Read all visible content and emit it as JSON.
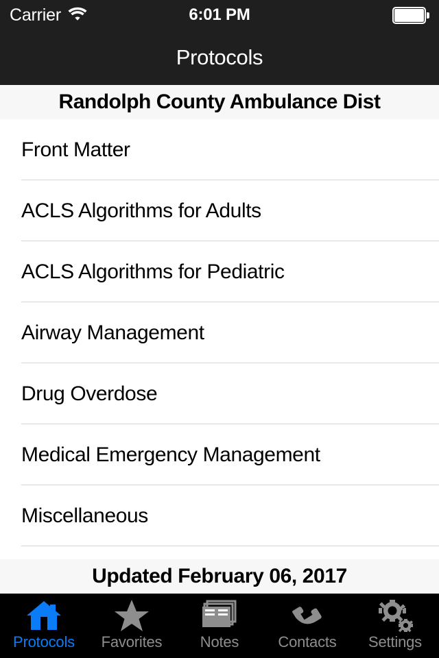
{
  "status_bar": {
    "carrier": "Carrier",
    "wifi_icon": "wifi-icon",
    "time": "6:01 PM",
    "battery_icon": "battery-full-icon"
  },
  "nav": {
    "title": "Protocols"
  },
  "section": {
    "header": "Randolph County Ambulance Dist"
  },
  "list": {
    "items": [
      {
        "label": "Front Matter"
      },
      {
        "label": "ACLS Algorithms for Adults"
      },
      {
        "label": "ACLS Algorithms for Pediatric"
      },
      {
        "label": "Airway Management"
      },
      {
        "label": "Drug Overdose"
      },
      {
        "label": "Medical Emergency Management"
      },
      {
        "label": "Miscellaneous"
      }
    ]
  },
  "footer": {
    "updated": "Updated February 06, 2017"
  },
  "tab_bar": {
    "tabs": [
      {
        "label": "Protocols",
        "icon": "home-icon",
        "active": true
      },
      {
        "label": "Favorites",
        "icon": "star-icon",
        "active": false
      },
      {
        "label": "Notes",
        "icon": "pages-icon",
        "active": false
      },
      {
        "label": "Contacts",
        "icon": "phone-icon",
        "active": false
      },
      {
        "label": "Settings",
        "icon": "gears-icon",
        "active": false
      }
    ]
  },
  "colors": {
    "accent": "#0a7cf8",
    "inactive": "#8e8e8e",
    "navbar_bg": "#1f1f1f",
    "tabbar_bg": "#000000",
    "band_bg": "#f7f7f7",
    "separator": "#d4d4d4"
  }
}
